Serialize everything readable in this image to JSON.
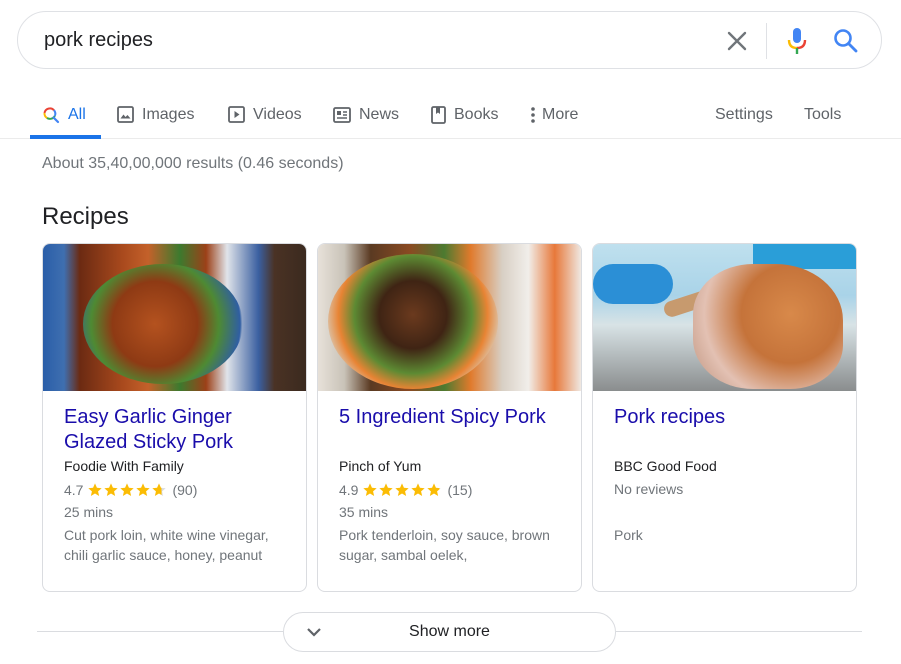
{
  "search": {
    "query": "pork recipes",
    "icons": {
      "clear": "close-icon",
      "voice": "microphone-icon",
      "submit": "search-icon"
    }
  },
  "tabs": [
    {
      "label": "All",
      "icon": "search-icon",
      "active": true
    },
    {
      "label": "Images",
      "icon": "image-icon",
      "active": false
    },
    {
      "label": "Videos",
      "icon": "play-icon",
      "active": false
    },
    {
      "label": "News",
      "icon": "news-icon",
      "active": false
    },
    {
      "label": "Books",
      "icon": "book-icon",
      "active": false
    },
    {
      "label": "More",
      "icon": "more-vert-icon",
      "active": false
    }
  ],
  "tools": {
    "settings": "Settings",
    "tools": "Tools"
  },
  "result_stats": "About 35,40,00,000 results (0.46 seconds)",
  "recipes": {
    "heading": "Recipes",
    "cards": [
      {
        "title": "Easy Garlic Ginger Glazed Sticky Pork",
        "source": "Foodie With Family",
        "rating": "4.7",
        "rating_value": 4.7,
        "reviews": "(90)",
        "time": "25 mins",
        "ingredients": "Cut pork loin, white wine vinegar, chili garlic sauce, honey, peanut",
        "image": "glazed-pork-bowl-photo"
      },
      {
        "title": "5 Ingredient Spicy Pork",
        "source": "Pinch of Yum",
        "rating": "4.9",
        "rating_value": 4.9,
        "reviews": "(15)",
        "time": "35 mins",
        "ingredients": "Pork tenderloin, soy sauce, brown sugar, sambal oelek,",
        "image": "spicy-pork-bowl-photo"
      },
      {
        "title": "Pork recipes",
        "source": "BBC Good Food",
        "no_reviews": "No reviews",
        "ingredients": "Pork",
        "image": "roast-pork-rack-photo"
      }
    ]
  },
  "show_more": {
    "label": "Show more"
  },
  "colors": {
    "accent": "#1a73e8",
    "link": "#1a0dab",
    "star": "#fbbc04",
    "muted": "#70757a",
    "border": "#dadce0"
  }
}
